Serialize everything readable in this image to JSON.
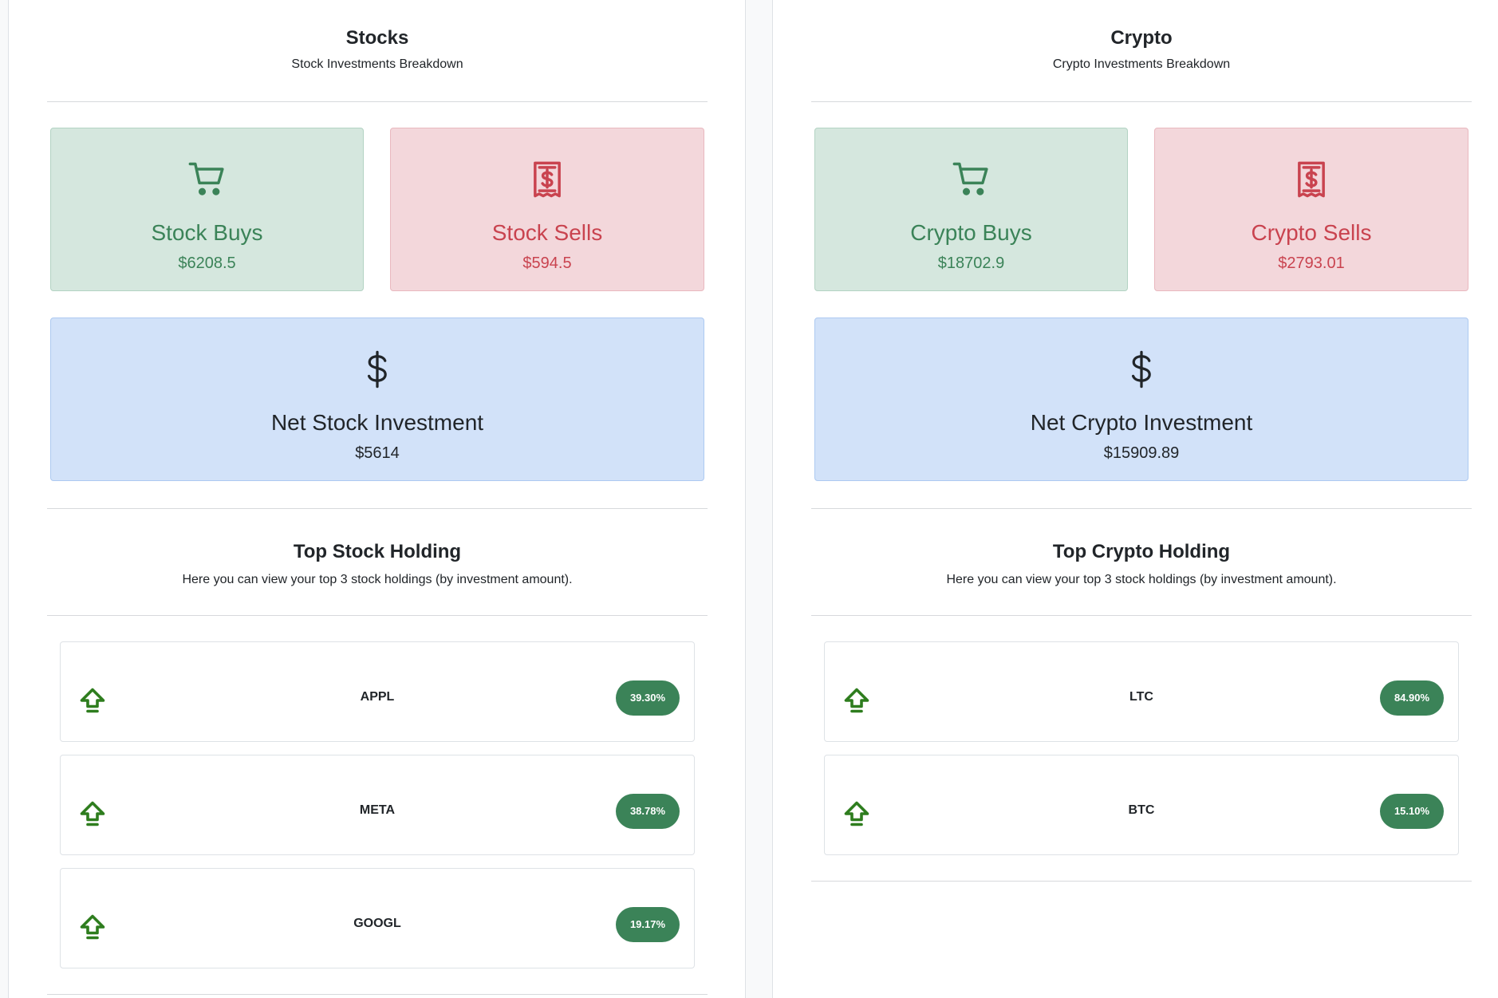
{
  "stocks": {
    "title": "Stocks",
    "subtitle": "Stock Investments Breakdown",
    "buys": {
      "label": "Stock Buys",
      "amount": "$6208.5",
      "icon": "cart-icon"
    },
    "sells": {
      "label": "Stock Sells",
      "amount": "$594.5",
      "icon": "receipt-icon"
    },
    "net": {
      "label": "Net Stock Investment",
      "amount": "$5614",
      "icon": "dollar-icon"
    },
    "holdings_title": "Top Stock Holding",
    "holdings_subtitle": "Here you can view your top 3 stock holdings (by investment amount).",
    "holdings": [
      {
        "symbol": "APPL",
        "percent": "39.30%"
      },
      {
        "symbol": "META",
        "percent": "38.78%"
      },
      {
        "symbol": "GOOGL",
        "percent": "19.17%"
      }
    ]
  },
  "crypto": {
    "title": "Crypto",
    "subtitle": "Crypto Investments Breakdown",
    "buys": {
      "label": "Crypto Buys",
      "amount": "$18702.9",
      "icon": "cart-icon"
    },
    "sells": {
      "label": "Crypto Sells",
      "amount": "$2793.01",
      "icon": "receipt-icon"
    },
    "net": {
      "label": "Net Crypto Investment",
      "amount": "$15909.89",
      "icon": "dollar-icon"
    },
    "holdings_title": "Top Crypto Holding",
    "holdings_subtitle": "Here you can view your top 3 stock holdings (by investment amount).",
    "holdings": [
      {
        "symbol": "LTC",
        "percent": "84.90%"
      },
      {
        "symbol": "BTC",
        "percent": "15.10%"
      }
    ]
  },
  "colors": {
    "buy": "#3b8358",
    "sell": "#c9434f",
    "net_bg": "#d2e2f9",
    "badge": "#3b8358",
    "up_arrow": "#2e7d1e"
  }
}
